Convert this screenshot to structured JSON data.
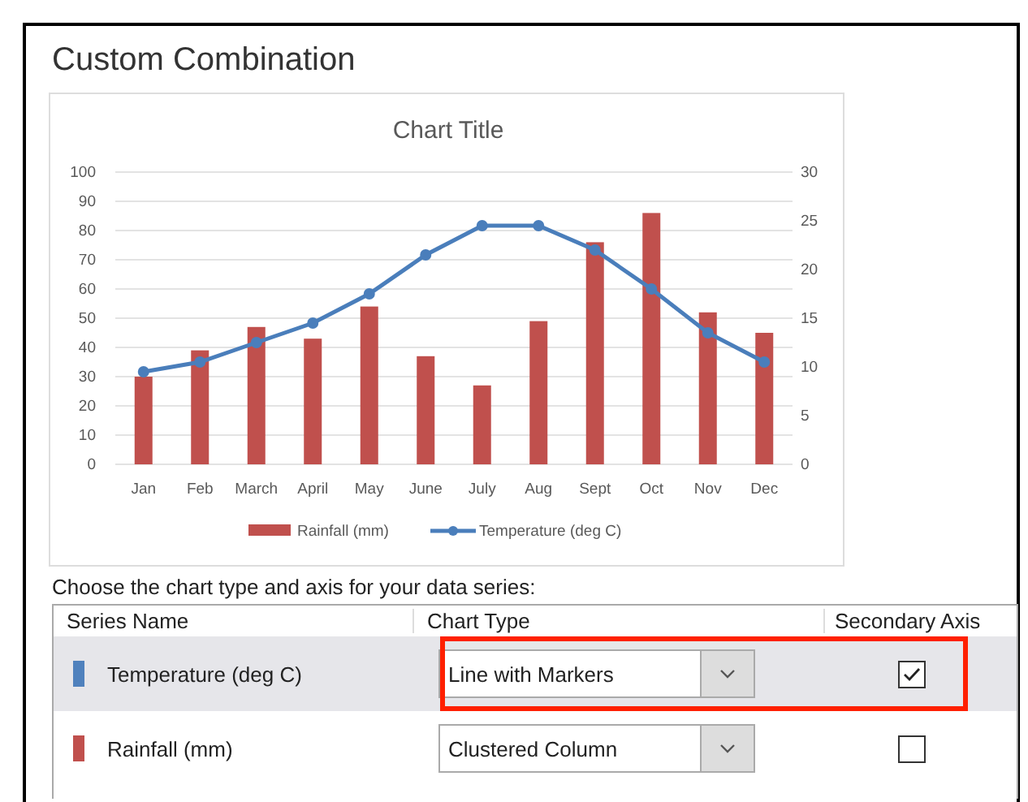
{
  "dialog": {
    "title": "Custom Combination"
  },
  "chart": {
    "chart_data": {
      "type": "bar",
      "title": "Chart Title",
      "categories": [
        "Jan",
        "Feb",
        "March",
        "April",
        "May",
        "June",
        "July",
        "Aug",
        "Sept",
        "Oct",
        "Nov",
        "Dec"
      ],
      "series": [
        {
          "name": "Rainfall (mm)",
          "color": "#c0504d",
          "values": [
            30,
            39,
            47,
            43,
            54,
            37,
            27,
            49,
            76,
            86,
            52,
            45
          ]
        },
        {
          "name": "Temperature (deg C)",
          "color": "#4a7ebb",
          "type": "line",
          "axis": "y2",
          "marker": "circle",
          "values": [
            9.5,
            10.5,
            12.5,
            14.5,
            17.5,
            21.5,
            24.5,
            24.5,
            22,
            18,
            13.5,
            10.5
          ]
        }
      ],
      "ylim": [
        0,
        100
      ],
      "yticks": [
        0,
        10,
        20,
        30,
        40,
        50,
        60,
        70,
        80,
        90,
        100
      ],
      "grid": true,
      "legend": "bottom",
      "y2lim": [
        0,
        30
      ],
      "y2ticks": [
        0,
        5,
        10,
        15,
        20,
        25,
        30
      ]
    }
  },
  "series_prompt": "Choose the chart type and axis for your data series:",
  "series_table": {
    "columns": [
      "Series Name",
      "Chart Type",
      "Secondary Axis"
    ],
    "rows": [
      {
        "selected": true,
        "color": "#4f81bd",
        "name": "Temperature (deg C)",
        "chart_type": "Line with Markers",
        "secondary_axis": true,
        "highlighted": true
      },
      {
        "selected": false,
        "color": "#c0504d",
        "name": "Rainfall (mm)",
        "chart_type": "Clustered Column",
        "secondary_axis": false,
        "highlighted": false
      }
    ]
  }
}
